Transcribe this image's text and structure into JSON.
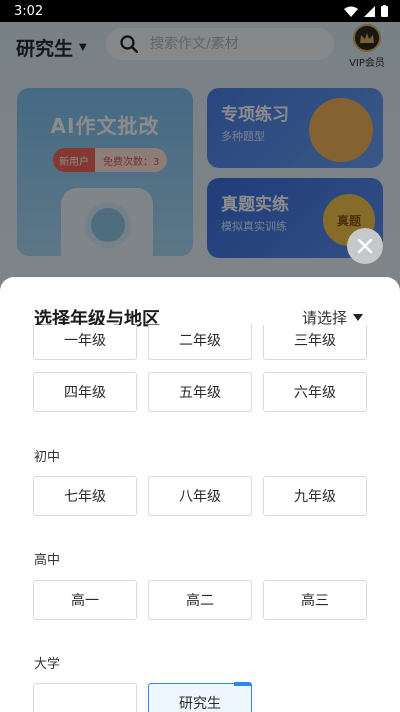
{
  "status_bar": {
    "time": "3:02"
  },
  "topbar": {
    "grade": "研究生",
    "search_placeholder": "搜索作文/素材",
    "vip_label": "VIP会员"
  },
  "cards": {
    "ai": {
      "title": "AI作文批改",
      "new_user": "新用户",
      "free_times": "免费次数：3"
    },
    "special": {
      "title": "专项练习",
      "subtitle": "多种题型"
    },
    "real": {
      "title": "真题实练",
      "subtitle": "模拟真实训练",
      "medal": "真题"
    }
  },
  "sheet": {
    "title": "选择年级与地区",
    "region": "请选择",
    "primary": [
      "一年级",
      "二年级",
      "三年级",
      "四年级",
      "五年级",
      "六年级"
    ],
    "junior_label": "初中",
    "junior": [
      "七年级",
      "八年级",
      "九年级"
    ],
    "senior_label": "高中",
    "senior": [
      "高一",
      "高二",
      "高三"
    ],
    "college_label": "大学",
    "selected": "研究生"
  },
  "colors": {
    "accent": "#2f86f3",
    "scrim": "rgba(0,0,0,0.45)"
  }
}
